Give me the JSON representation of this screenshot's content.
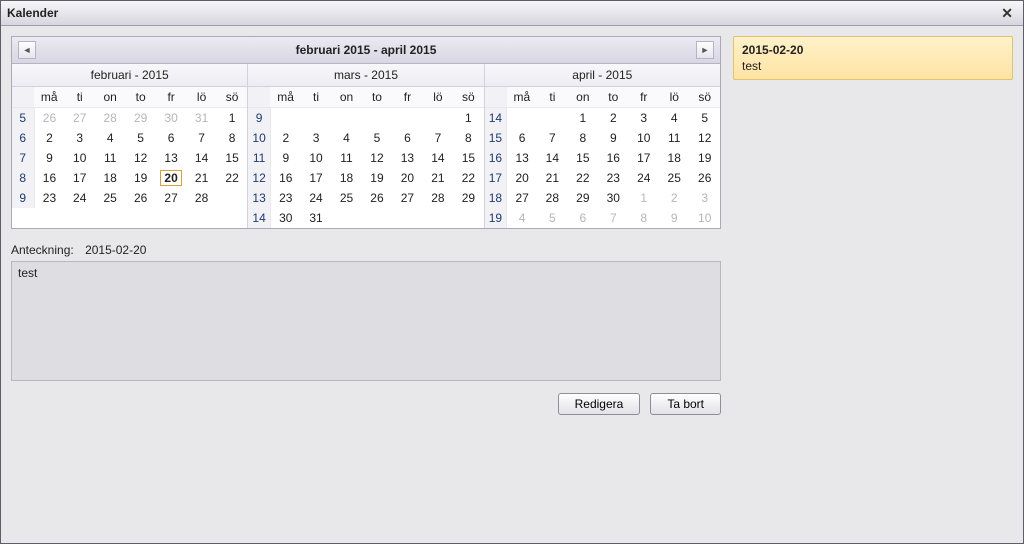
{
  "window": {
    "title": "Kalender"
  },
  "nav": {
    "range": "februari 2015 - april 2015"
  },
  "dow": [
    "må",
    "ti",
    "on",
    "to",
    "fr",
    "lö",
    "sö"
  ],
  "months": [
    {
      "title": "februari - 2015",
      "weeks": [
        {
          "wk": 5,
          "days": [
            {
              "d": 26,
              "o": true
            },
            {
              "d": 27,
              "o": true
            },
            {
              "d": 28,
              "o": true
            },
            {
              "d": 29,
              "o": true
            },
            {
              "d": 30,
              "o": true
            },
            {
              "d": 31,
              "o": true
            },
            {
              "d": 1
            }
          ]
        },
        {
          "wk": 6,
          "days": [
            {
              "d": 2
            },
            {
              "d": 3
            },
            {
              "d": 4
            },
            {
              "d": 5
            },
            {
              "d": 6
            },
            {
              "d": 7
            },
            {
              "d": 8
            }
          ]
        },
        {
          "wk": 7,
          "days": [
            {
              "d": 9
            },
            {
              "d": 10
            },
            {
              "d": 11
            },
            {
              "d": 12
            },
            {
              "d": 13
            },
            {
              "d": 14
            },
            {
              "d": 15
            }
          ]
        },
        {
          "wk": 8,
          "days": [
            {
              "d": 16
            },
            {
              "d": 17
            },
            {
              "d": 18
            },
            {
              "d": 19
            },
            {
              "d": 20,
              "sel": true
            },
            {
              "d": 21
            },
            {
              "d": 22
            }
          ]
        },
        {
          "wk": 9,
          "days": [
            {
              "d": 23
            },
            {
              "d": 24
            },
            {
              "d": 25
            },
            {
              "d": 26
            },
            {
              "d": 27
            },
            {
              "d": 28
            },
            {
              "d": "",
              "o": true
            }
          ]
        }
      ]
    },
    {
      "title": "mars - 2015",
      "weeks": [
        {
          "wk": 9,
          "days": [
            {
              "d": "",
              "o": true
            },
            {
              "d": "",
              "o": true
            },
            {
              "d": "",
              "o": true
            },
            {
              "d": "",
              "o": true
            },
            {
              "d": "",
              "o": true
            },
            {
              "d": "",
              "o": true
            },
            {
              "d": 1
            }
          ]
        },
        {
          "wk": 10,
          "days": [
            {
              "d": 2
            },
            {
              "d": 3
            },
            {
              "d": 4
            },
            {
              "d": 5
            },
            {
              "d": 6
            },
            {
              "d": 7
            },
            {
              "d": 8
            }
          ]
        },
        {
          "wk": 11,
          "days": [
            {
              "d": 9
            },
            {
              "d": 10
            },
            {
              "d": 11
            },
            {
              "d": 12
            },
            {
              "d": 13
            },
            {
              "d": 14
            },
            {
              "d": 15
            }
          ]
        },
        {
          "wk": 12,
          "days": [
            {
              "d": 16
            },
            {
              "d": 17
            },
            {
              "d": 18
            },
            {
              "d": 19
            },
            {
              "d": 20
            },
            {
              "d": 21
            },
            {
              "d": 22
            }
          ]
        },
        {
          "wk": 13,
          "days": [
            {
              "d": 23
            },
            {
              "d": 24
            },
            {
              "d": 25
            },
            {
              "d": 26
            },
            {
              "d": 27
            },
            {
              "d": 28
            },
            {
              "d": 29
            }
          ]
        },
        {
          "wk": 14,
          "days": [
            {
              "d": 30
            },
            {
              "d": 31
            },
            {
              "d": "",
              "o": true
            },
            {
              "d": "",
              "o": true
            },
            {
              "d": "",
              "o": true
            },
            {
              "d": "",
              "o": true
            },
            {
              "d": "",
              "o": true
            }
          ]
        }
      ]
    },
    {
      "title": "april - 2015",
      "weeks": [
        {
          "wk": 14,
          "days": [
            {
              "d": "",
              "o": true
            },
            {
              "d": "",
              "o": true
            },
            {
              "d": 1
            },
            {
              "d": 2
            },
            {
              "d": 3
            },
            {
              "d": 4
            },
            {
              "d": 5
            }
          ]
        },
        {
          "wk": 15,
          "days": [
            {
              "d": 6
            },
            {
              "d": 7
            },
            {
              "d": 8
            },
            {
              "d": 9
            },
            {
              "d": 10
            },
            {
              "d": 11
            },
            {
              "d": 12
            }
          ]
        },
        {
          "wk": 16,
          "days": [
            {
              "d": 13
            },
            {
              "d": 14
            },
            {
              "d": 15
            },
            {
              "d": 16
            },
            {
              "d": 17
            },
            {
              "d": 18
            },
            {
              "d": 19
            }
          ]
        },
        {
          "wk": 17,
          "days": [
            {
              "d": 20
            },
            {
              "d": 21
            },
            {
              "d": 22
            },
            {
              "d": 23
            },
            {
              "d": 24
            },
            {
              "d": 25
            },
            {
              "d": 26
            }
          ]
        },
        {
          "wk": 18,
          "days": [
            {
              "d": 27
            },
            {
              "d": 28
            },
            {
              "d": 29
            },
            {
              "d": 30
            },
            {
              "d": 1,
              "o": true
            },
            {
              "d": 2,
              "o": true
            },
            {
              "d": 3,
              "o": true
            }
          ]
        },
        {
          "wk": 19,
          "days": [
            {
              "d": 4,
              "o": true
            },
            {
              "d": 5,
              "o": true
            },
            {
              "d": 6,
              "o": true
            },
            {
              "d": 7,
              "o": true
            },
            {
              "d": 8,
              "o": true
            },
            {
              "d": 9,
              "o": true
            },
            {
              "d": 10,
              "o": true
            }
          ]
        }
      ]
    }
  ],
  "annotation": {
    "label": "Anteckning:",
    "date": "2015-02-20",
    "text": "test"
  },
  "buttons": {
    "edit": "Redigera",
    "delete": "Ta bort"
  },
  "side_note": {
    "date": "2015-02-20",
    "text": "test"
  }
}
